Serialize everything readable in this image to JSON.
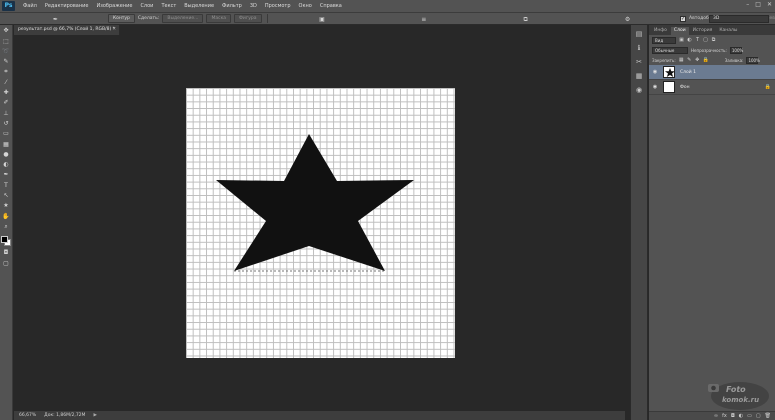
{
  "menu": {
    "app_logo": "Ps",
    "items": [
      "Файл",
      "Редактирование",
      "Изображение",
      "Слои",
      "Текст",
      "Выделение",
      "Фильтр",
      "3D",
      "Просмотр",
      "Окно",
      "Справка"
    ],
    "window_controls": [
      "–",
      "□",
      "✕"
    ]
  },
  "options": {
    "tool_mode": "Контур",
    "make_label": "Сделать:",
    "selection_btn": "Выделение...",
    "mask_btn": "Маска",
    "shape_btn": "Фигура",
    "auto_add_delete_label": "Автодобавление",
    "auto_add_delete_checked": true,
    "align_edges_label": "Выравн. краев",
    "align_edges_checked": false,
    "workspace": "3D"
  },
  "document": {
    "tab_title": "результат.psd @ 66,7% (Слой 1, RGB/8) *",
    "close": "✕"
  },
  "status": {
    "zoom": "66,67%",
    "doc_size": "Док: 1,86M/2,72M",
    "arrow": "▶"
  },
  "panel": {
    "tabs": [
      "Инфо",
      "Слои",
      "История",
      "Каналы"
    ],
    "active_tab": "Слои",
    "filter_kind": "Вид",
    "blend_mode": "Обычные",
    "opacity_label": "Непрозрачность:",
    "opacity_value": "100%",
    "lock_label": "Закрепить:",
    "fill_label": "Заливка:",
    "fill_value": "100%",
    "layers": [
      {
        "name": "Слой 1",
        "selected": true,
        "visible": true,
        "thumb": "star"
      },
      {
        "name": "Фон",
        "selected": false,
        "visible": true,
        "thumb": "white",
        "locked": true
      }
    ]
  },
  "watermark": {
    "line1": "Foto",
    "line2": "komok.ru"
  },
  "colors": {
    "chrome": "#535353",
    "workspace": "#282828",
    "selected_layer": "#6b7b91",
    "grid": "#bdbdbd",
    "star_fill": "#111111"
  }
}
